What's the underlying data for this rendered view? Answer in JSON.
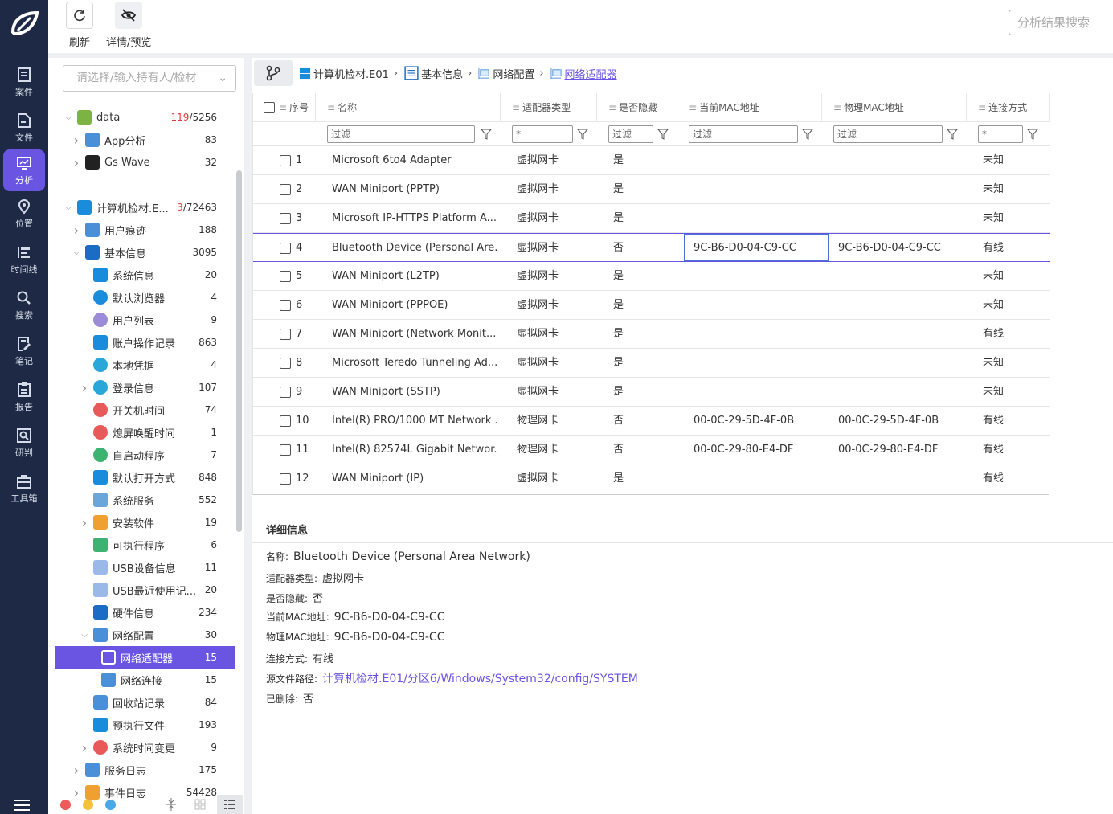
{
  "nav": {
    "items": [
      {
        "label": "案件",
        "icon": "case-icon"
      },
      {
        "label": "文件",
        "icon": "file-icon"
      },
      {
        "label": "分析",
        "icon": "analysis-icon"
      },
      {
        "label": "位置",
        "icon": "location-icon"
      },
      {
        "label": "时间线",
        "icon": "timeline-icon"
      },
      {
        "label": "搜索",
        "icon": "search-icon"
      },
      {
        "label": "笔记",
        "icon": "note-icon"
      },
      {
        "label": "报告",
        "icon": "report-icon"
      },
      {
        "label": "研判",
        "icon": "judge-icon"
      },
      {
        "label": "工具箱",
        "icon": "toolbox-icon"
      }
    ]
  },
  "toolbar": {
    "refresh_label": "刷新",
    "preview_label": "详情/预览",
    "search_placeholder": "分析结果搜索"
  },
  "tree": {
    "select_placeholder": "请选择/输入持有人/检材",
    "rows": [
      {
        "label": "data",
        "count_a": "119",
        "count_b": "/5256"
      },
      {
        "label": "App分析",
        "count": "83"
      },
      {
        "label": "Gs Wave",
        "count": "32"
      },
      {
        "label": "计算机检材.E...",
        "count_a": "3",
        "count_b": "/72463"
      },
      {
        "label": "用户痕迹",
        "count": "188"
      },
      {
        "label": "基本信息",
        "count": "3095"
      },
      {
        "label": "系统信息",
        "count": "20"
      },
      {
        "label": "默认浏览器",
        "count": "4"
      },
      {
        "label": "用户列表",
        "count": "9"
      },
      {
        "label": "账户操作记录",
        "count": "863"
      },
      {
        "label": "本地凭据",
        "count": "4"
      },
      {
        "label": "登录信息",
        "count": "107"
      },
      {
        "label": "开关机时间",
        "count": "74"
      },
      {
        "label": "熄屏唤醒时间",
        "count": "1"
      },
      {
        "label": "自启动程序",
        "count": "7"
      },
      {
        "label": "默认打开方式",
        "count": "848"
      },
      {
        "label": "系统服务",
        "count": "552"
      },
      {
        "label": "安装软件",
        "count": "19"
      },
      {
        "label": "可执行程序",
        "count": "6"
      },
      {
        "label": "USB设备信息",
        "count": "11"
      },
      {
        "label": "USB最近使用记...",
        "count": "20"
      },
      {
        "label": "硬件信息",
        "count": "234"
      },
      {
        "label": "网络配置",
        "count": "30"
      },
      {
        "label": "网络适配器",
        "count": "15"
      },
      {
        "label": "网络连接",
        "count": "15"
      },
      {
        "label": "回收站记录",
        "count": "84"
      },
      {
        "label": "预执行文件",
        "count": "193"
      },
      {
        "label": "系统时间变更",
        "count": "9"
      },
      {
        "label": "服务日志",
        "count": "175"
      },
      {
        "label": "事件日志",
        "count": "54428"
      }
    ]
  },
  "breadcrumb": [
    "计算机检材.E01",
    "基本信息",
    "网络配置",
    "网络适配器"
  ],
  "table": {
    "headers": {
      "index": "序号",
      "name": "名称",
      "type": "适配器类型",
      "hidden": "是否隐藏",
      "cur_mac": "当前MAC地址",
      "phy_mac": "物理MAC地址",
      "conn": "连接方式"
    },
    "filters": {
      "name": "过滤",
      "type": "*",
      "hidden": "过滤",
      "cur_mac": "过滤",
      "phy_mac": "过滤",
      "conn": "*"
    },
    "rows": [
      {
        "idx": "1",
        "name": "Microsoft 6to4 Adapter",
        "type": "虚拟网卡",
        "hidden": "是",
        "cur_mac": "",
        "phy_mac": "",
        "conn": "未知"
      },
      {
        "idx": "2",
        "name": "WAN Miniport (PPTP)",
        "type": "虚拟网卡",
        "hidden": "是",
        "cur_mac": "",
        "phy_mac": "",
        "conn": "未知"
      },
      {
        "idx": "3",
        "name": "Microsoft IP-HTTPS Platform A...",
        "type": "虚拟网卡",
        "hidden": "是",
        "cur_mac": "",
        "phy_mac": "",
        "conn": "未知"
      },
      {
        "idx": "4",
        "name": "Bluetooth Device (Personal Are...",
        "type": "虚拟网卡",
        "hidden": "否",
        "cur_mac": "9C-B6-D0-04-C9-CC",
        "phy_mac": "9C-B6-D0-04-C9-CC",
        "conn": "有线"
      },
      {
        "idx": "5",
        "name": "WAN Miniport (L2TP)",
        "type": "虚拟网卡",
        "hidden": "是",
        "cur_mac": "",
        "phy_mac": "",
        "conn": "未知"
      },
      {
        "idx": "6",
        "name": "WAN Miniport (PPPOE)",
        "type": "虚拟网卡",
        "hidden": "是",
        "cur_mac": "",
        "phy_mac": "",
        "conn": "未知"
      },
      {
        "idx": "7",
        "name": "WAN Miniport (Network Monit...",
        "type": "虚拟网卡",
        "hidden": "是",
        "cur_mac": "",
        "phy_mac": "",
        "conn": "有线"
      },
      {
        "idx": "8",
        "name": "Microsoft Teredo Tunneling Ad...",
        "type": "虚拟网卡",
        "hidden": "是",
        "cur_mac": "",
        "phy_mac": "",
        "conn": "未知"
      },
      {
        "idx": "9",
        "name": "WAN Miniport (SSTP)",
        "type": "虚拟网卡",
        "hidden": "是",
        "cur_mac": "",
        "phy_mac": "",
        "conn": "未知"
      },
      {
        "idx": "10",
        "name": "Intel(R) PRO/1000 MT Network ...",
        "type": "物理网卡",
        "hidden": "否",
        "cur_mac": "00-0C-29-5D-4F-0B",
        "phy_mac": "00-0C-29-5D-4F-0B",
        "conn": "有线"
      },
      {
        "idx": "11",
        "name": "Intel(R) 82574L Gigabit Networ...",
        "type": "物理网卡",
        "hidden": "否",
        "cur_mac": "00-0C-29-80-E4-DF",
        "phy_mac": "00-0C-29-80-E4-DF",
        "conn": "有线"
      },
      {
        "idx": "12",
        "name": "WAN Miniport (IP)",
        "type": "虚拟网卡",
        "hidden": "是",
        "cur_mac": "",
        "phy_mac": "",
        "conn": "有线"
      }
    ]
  },
  "detail": {
    "title": "详细信息",
    "fields": [
      {
        "label": "名称:",
        "value": "Bluetooth Device (Personal Area Network)"
      },
      {
        "label": "适配器类型:",
        "value": "虚拟网卡"
      },
      {
        "label": "是否隐藏:",
        "value": "否"
      },
      {
        "label": "当前MAC地址:",
        "value": "9C-B6-D0-04-C9-CC"
      },
      {
        "label": "物理MAC地址:",
        "value": "9C-B6-D0-04-C9-CC"
      },
      {
        "label": "连接方式:",
        "value": "有线"
      },
      {
        "label": "源文件路径:",
        "value": "计算机检材.E01/分区6/Windows/System32/config/SYSTEM"
      },
      {
        "label": "已删除:",
        "value": "否"
      }
    ]
  },
  "colors": {
    "accent": "#6a55e3",
    "nav_bg": "#1e2a45",
    "count_red": "#e03a3a"
  }
}
